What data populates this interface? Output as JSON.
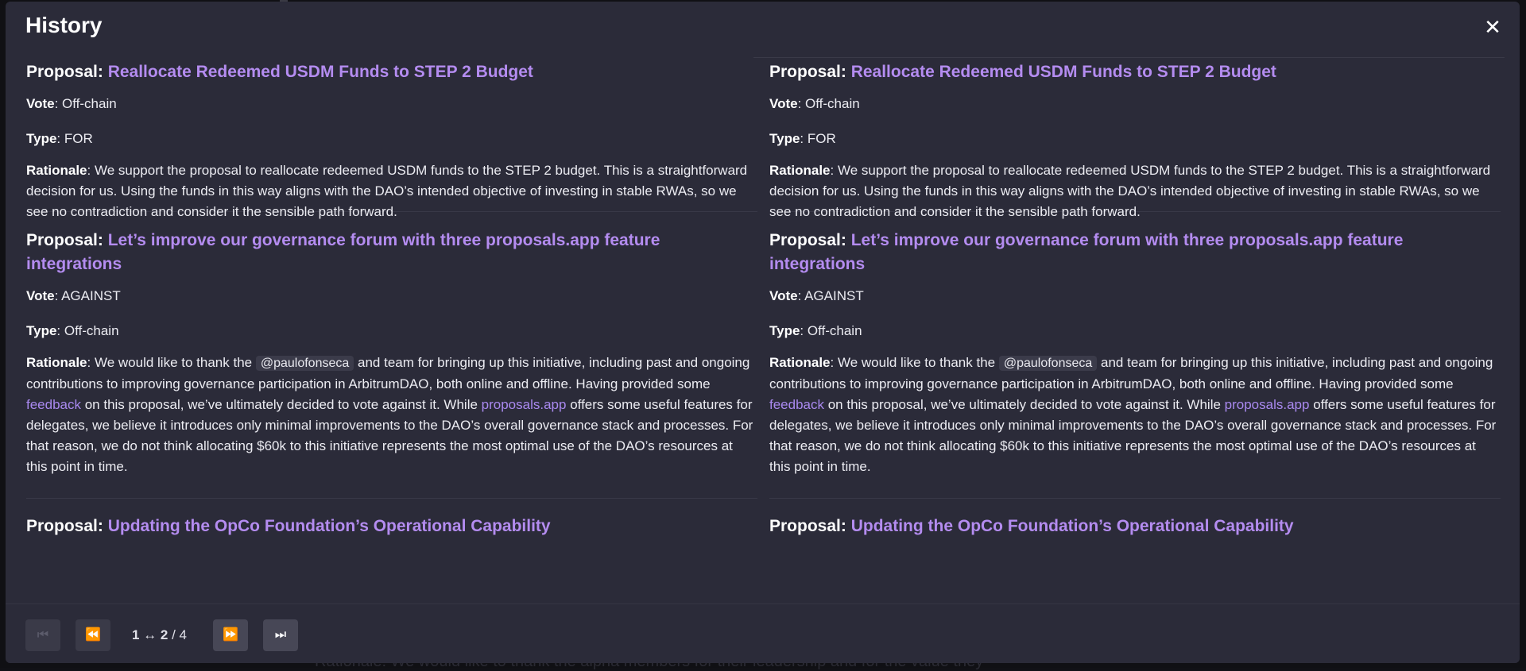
{
  "modal": {
    "title": "History",
    "close_icon": "close-icon"
  },
  "columns": [
    {
      "proposals": [
        {
          "label": "Proposal:",
          "title": "Reallocate Redeemed USDM Funds to STEP 2 Budget",
          "vote_label": "Vote",
          "vote": ": Off-chain",
          "type_label": "Type",
          "type": ": FOR",
          "rationale_label": "Rationale",
          "rationale": ": We support the proposal to reallocate redeemed USDM funds to the STEP 2 budget. This is a straightforward decision for us. Using the funds in this way aligns with the DAO’s intended objective of investing in stable RWAs, so we see no contradiction and consider it the sensible path forward."
        },
        {
          "label": "Proposal:",
          "title": "Let’s improve our governance forum with three proposals.app feature integrations",
          "vote_label": "Vote",
          "vote": ": AGAINST",
          "type_label": "Type",
          "type": ": Off-chain",
          "rationale_label": "Rationale",
          "rationale_part1": ": We would like to thank the ",
          "mention": "@paulofonseca",
          "rationale_part2": " and team for bringing up this initiative, including past and ongoing contributions to improving governance participation in ArbitrumDAO, both online and offline. Having provided some ",
          "link1": "feedback",
          "rationale_part3": " on this proposal, we’ve ultimately decided to vote against it. While ",
          "link2": "proposals.app",
          "rationale_part4": " offers some useful features for delegates, we believe it introduces only minimal improvements to the DAO’s overall governance stack and processes. For that reason, we do not think allocating $60k to this initiative represents the most optimal use of the DAO’s resources at this point in time."
        },
        {
          "label": "Proposal:",
          "title": "Updating the OpCo Foundation’s Operational Capability"
        }
      ]
    },
    {
      "proposals": [
        {
          "label": "Proposal:",
          "title": "Reallocate Redeemed USDM Funds to STEP 2 Budget",
          "vote_label": "Vote",
          "vote": ": Off-chain",
          "type_label": "Type",
          "type": ": FOR",
          "rationale_label": "Rationale",
          "rationale": ": We support the proposal to reallocate redeemed USDM funds to the STEP 2 budget. This is a straightforward decision for us. Using the funds in this way aligns with the DAO’s intended objective of investing in stable RWAs, so we see no contradiction and consider it the sensible path forward."
        },
        {
          "label": "Proposal:",
          "title": "Let’s improve our governance forum with three proposals.app feature integrations",
          "vote_label": "Vote",
          "vote": ": AGAINST",
          "type_label": "Type",
          "type": ": Off-chain",
          "rationale_label": "Rationale",
          "rationale_part1": ": We would like to thank the ",
          "mention": "@paulofonseca",
          "rationale_part2": " and team for bringing up this initiative, including past and ongoing contributions to improving governance participation in ArbitrumDAO, both online and offline. Having provided some ",
          "link1": "feedback",
          "rationale_part3": " on this proposal, we’ve ultimately decided to vote against it. While ",
          "link2": "proposals.app",
          "rationale_part4": " offers some useful features for delegates, we believe it introduces only minimal improvements to the DAO’s overall governance stack and processes. For that reason, we do not think allocating $60k to this initiative represents the most optimal use of the DAO’s resources at this point in time."
        },
        {
          "label": "Proposal:",
          "title": "Updating the OpCo Foundation’s Operational Capability"
        }
      ]
    }
  ],
  "pagination": {
    "first_icon": "first-page-icon",
    "prev_icon": "prev-page-icon",
    "next_icon": "next-page-icon",
    "last_icon": "last-page-icon",
    "first_glyph": "⏮",
    "prev_glyph": "⏪",
    "next_glyph": "⏩",
    "last_glyph": "⏭",
    "range": "1 ↔ 2",
    "total": " / 4"
  },
  "background": {
    "text": "Rationale: We would like to thank the alpha members for their leadership and for the value they"
  },
  "colors": {
    "modal_bg": "#2b2b39",
    "link": "#b48cf0",
    "text": "#ececf2"
  }
}
